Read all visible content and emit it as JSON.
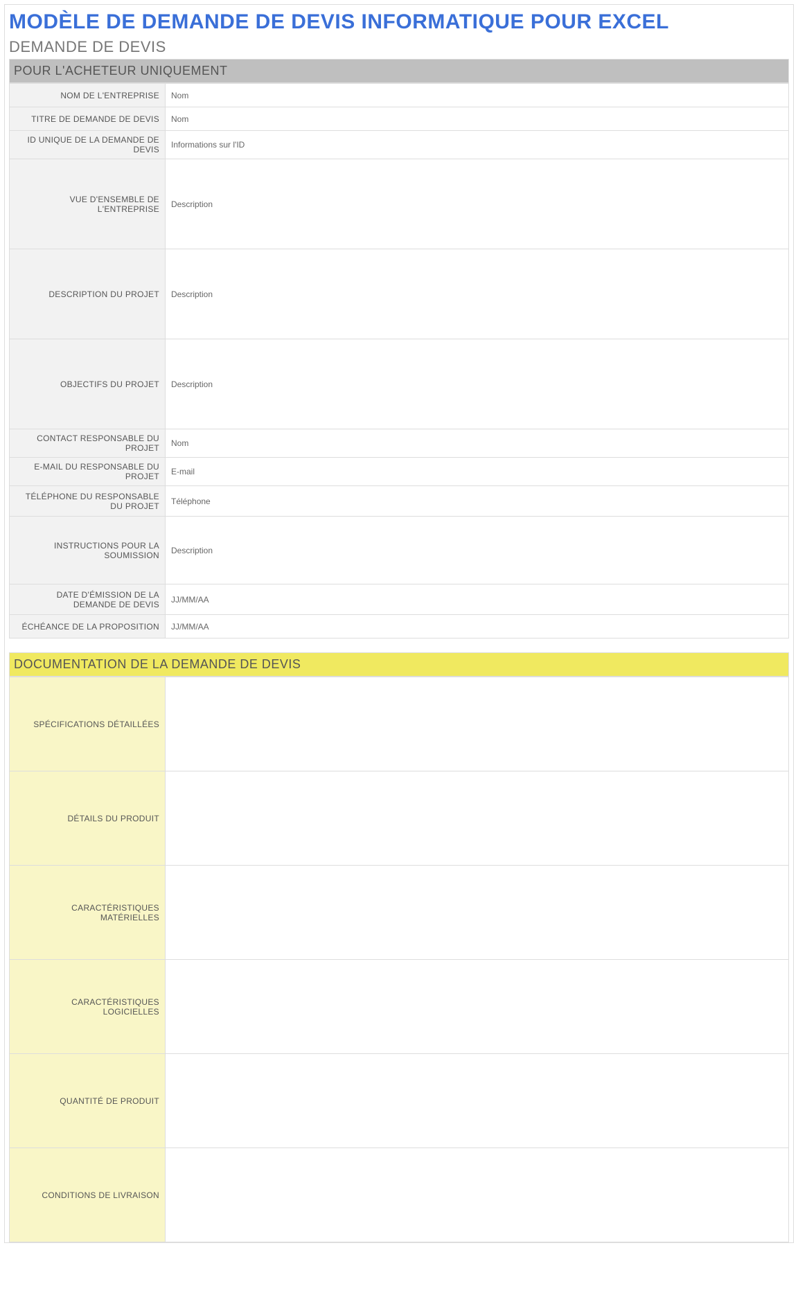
{
  "title": "MODÈLE DE DEMANDE DE DEVIS INFORMATIQUE POUR EXCEL",
  "subtitle": "DEMANDE DE DEVIS",
  "buyer_section": {
    "header": "POUR L'ACHETEUR UNIQUEMENT",
    "rows": [
      {
        "label": "NOM DE L'ENTREPRISE",
        "value": "Nom",
        "size": "sm"
      },
      {
        "label": "TITRE DE DEMANDE DE DEVIS",
        "value": "Nom",
        "size": "sm"
      },
      {
        "label": "ID UNIQUE DE LA DEMANDE DE DEVIS",
        "value": "Informations sur l'ID",
        "size": "sm"
      },
      {
        "label": "VUE D'ENSEMBLE DE L'ENTREPRISE",
        "value": "Description",
        "size": "lg"
      },
      {
        "label": "DESCRIPTION DU PROJET",
        "value": "Description",
        "size": "lg"
      },
      {
        "label": "OBJECTIFS DU PROJET",
        "value": "Description",
        "size": "lg"
      },
      {
        "label": "CONTACT RESPONSABLE DU PROJET",
        "value": "Nom",
        "size": "sm"
      },
      {
        "label": "E-MAIL DU RESPONSABLE DU PROJET",
        "value": "E-mail",
        "size": "sm"
      },
      {
        "label": "TÉLÉPHONE DU RESPONSABLE DU PROJET",
        "value": "Téléphone",
        "size": "md"
      },
      {
        "label": "INSTRUCTIONS POUR LA SOUMISSION",
        "value": "Description",
        "size": "submission"
      },
      {
        "label": "DATE D'ÉMISSION DE LA DEMANDE DE DEVIS",
        "value": "JJ/MM/AA",
        "size": "md"
      },
      {
        "label": "ÉCHÉANCE DE LA PROPOSITION",
        "value": "JJ/MM/AA",
        "size": "sm"
      }
    ]
  },
  "doc_section": {
    "header": "DOCUMENTATION DE LA DEMANDE DE DEVIS",
    "rows": [
      {
        "label": "SPÉCIFICATIONS DÉTAILLÉES",
        "value": ""
      },
      {
        "label": "DÉTAILS DU PRODUIT",
        "value": ""
      },
      {
        "label": "CARACTÉRISTIQUES MATÉRIELLES",
        "value": ""
      },
      {
        "label": "CARACTÉRISTIQUES LOGICIELLES",
        "value": ""
      },
      {
        "label": "QUANTITÉ DE PRODUIT",
        "value": ""
      },
      {
        "label": "CONDITIONS DE LIVRAISON",
        "value": ""
      }
    ]
  }
}
